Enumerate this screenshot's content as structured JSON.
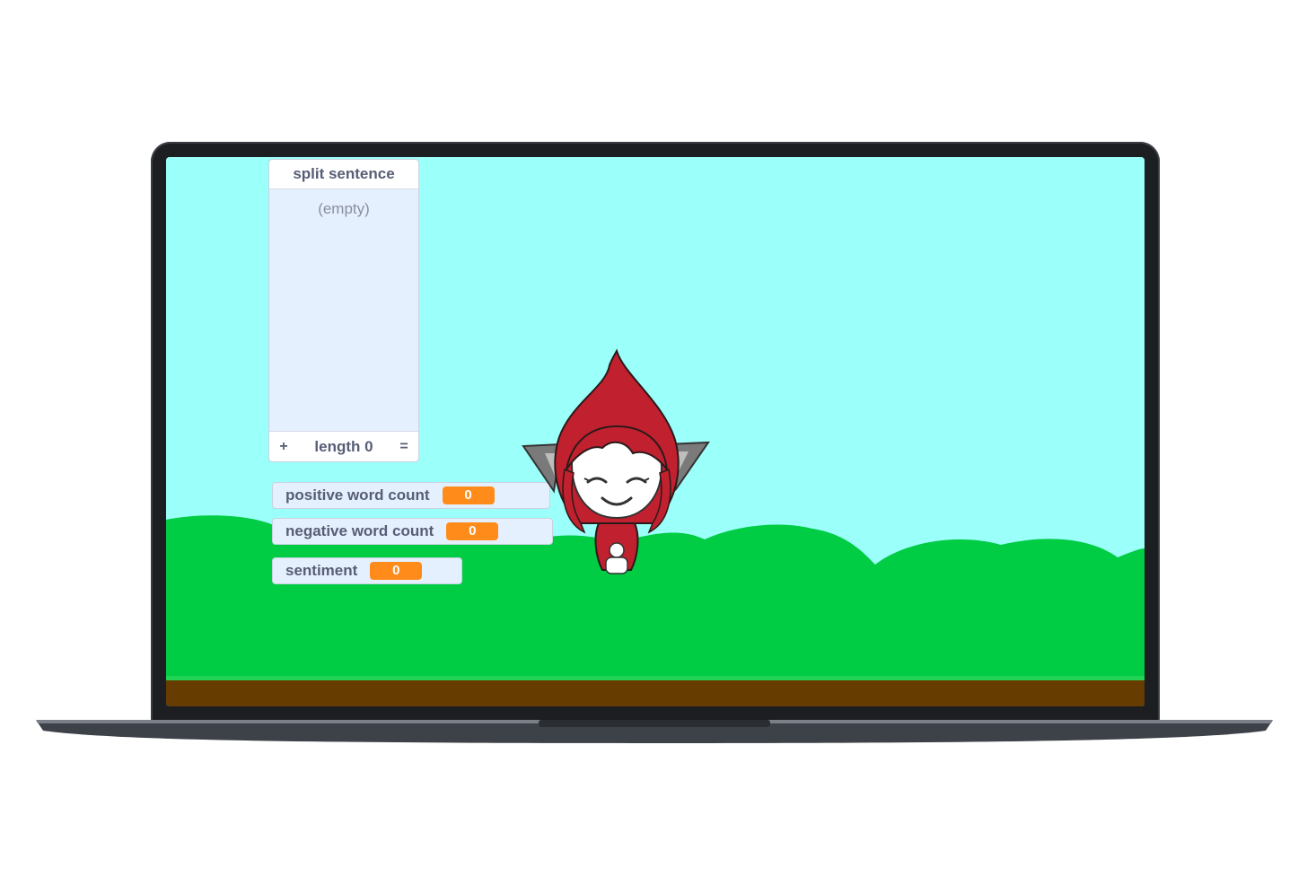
{
  "stage": {
    "colors": {
      "sky": "#9bfffa",
      "grass": "#00cc44",
      "dirt": "#663c00",
      "monitor_value": "#ff8c1a"
    }
  },
  "list_monitor": {
    "title": "split sentence",
    "empty_text": "(empty)",
    "add_button": "+",
    "length_label": "length 0",
    "resize_button": "="
  },
  "variables": [
    {
      "label": "positive word count",
      "value": "0"
    },
    {
      "label": "negative word count",
      "value": "0"
    },
    {
      "label": "sentiment",
      "value": "0"
    }
  ],
  "sprite": {
    "icon": "red-leaf-haired-character"
  }
}
